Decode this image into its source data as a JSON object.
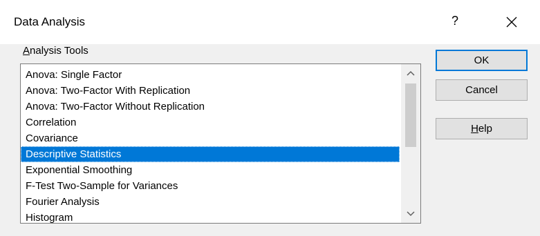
{
  "dialog": {
    "title": "Data Analysis",
    "help_label": "?",
    "close_icon": "close-icon"
  },
  "group": {
    "label_access": "A",
    "label_rest": "nalysis Tools"
  },
  "tools": [
    "Anova: Single Factor",
    "Anova: Two-Factor With Replication",
    "Anova: Two-Factor Without Replication",
    "Correlation",
    "Covariance",
    "Descriptive Statistics",
    "Exponential Smoothing",
    "F-Test Two-Sample for Variances",
    "Fourier Analysis",
    "Histogram"
  ],
  "selected_tool": "Descriptive Statistics",
  "buttons": {
    "ok": "OK",
    "cancel": "Cancel",
    "help_access": "H",
    "help_rest": "elp"
  },
  "scrollbar": {
    "up_icon": "chevron-up-icon",
    "down_icon": "chevron-down-icon"
  },
  "colors": {
    "selection": "#0078d7",
    "default_button_border": "#0078d7"
  }
}
